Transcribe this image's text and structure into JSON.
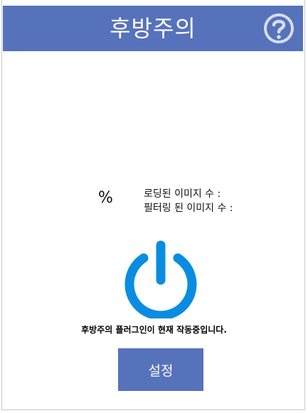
{
  "app": {
    "title": "후방주의",
    "help_icon": "question-circle-icon"
  },
  "stats": {
    "percent": "%",
    "loaded_label": "로딩된 이미지 수 :",
    "filtered_label": "필터링 된 이미지 수 :"
  },
  "power": {
    "icon": "power-icon",
    "color": "#0a8de0",
    "status": "후방주의 플러그인이 현재 작동중입니다."
  },
  "settings": {
    "label": "설정"
  },
  "colors": {
    "header_bg": "#5672bb",
    "button_bg": "#5672bb"
  }
}
